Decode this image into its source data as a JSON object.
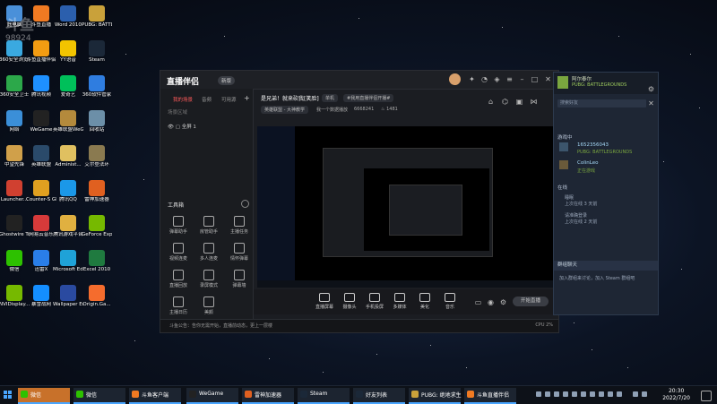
{
  "desktop_icons": [
    {
      "label": "此电脑",
      "color": "#4a90d9"
    },
    {
      "label": "斗鱼直播",
      "color": "#f07a22"
    },
    {
      "label": "Word 2010",
      "color": "#2b5fad"
    },
    {
      "label": "PUBG: BATTLEGROUNDS",
      "color": "#c9a13a"
    },
    {
      "label": "360安全浏览器",
      "color": "#3aa9e0"
    },
    {
      "label": "斗鱼直播伴侣",
      "color": "#f39c12"
    },
    {
      "label": "YY语音",
      "color": "#f2c400"
    },
    {
      "label": "Steam",
      "color": "#1b2838"
    },
    {
      "label": "360安全卫士",
      "color": "#2ca84a"
    },
    {
      "label": "腾讯视频",
      "color": "#1e90ff"
    },
    {
      "label": "爱奇艺",
      "color": "#00c05a"
    },
    {
      "label": "360软件管家",
      "color": "#2f7de0"
    },
    {
      "label": "网络",
      "color": "#3b8fd8"
    },
    {
      "label": "WeGame",
      "color": "#222"
    },
    {
      "label": "英雄联盟WeGame版",
      "color": "#b48a3c"
    },
    {
      "label": "回收站",
      "color": "#6c8fa8"
    },
    {
      "label": "中望先锋",
      "color": "#d0a04a"
    },
    {
      "label": "英雄联盟",
      "color": "#2a4a6a"
    },
    {
      "label": "Administ...",
      "color": "#e0c060"
    },
    {
      "label": "艾尔登法环",
      "color": "#8a7a50"
    },
    {
      "label": "Launcher...",
      "color": "#d04030"
    },
    {
      "label": "Counter-S Global Off...",
      "color": "#e0a020"
    },
    {
      "label": "腾讯QQ",
      "color": "#1b98e8"
    },
    {
      "label": "雷神加速器",
      "color": "#e06020"
    },
    {
      "label": "Ghostwire Tokyo",
      "color": "#222"
    },
    {
      "label": "网易云音乐",
      "color": "#d63a3a"
    },
    {
      "label": "腾讯游戏平台",
      "color": "#e0b040"
    },
    {
      "label": "GeForce Experience",
      "color": "#76b900"
    },
    {
      "label": "微信",
      "color": "#2dc100"
    },
    {
      "label": "迅雷X",
      "color": "#2a7ee8"
    },
    {
      "label": "Microsoft Edge",
      "color": "#1fa2d8"
    },
    {
      "label": "Excel 2010",
      "color": "#1f7a3f"
    },
    {
      "label": "NVIDisplay...",
      "color": "#76b900"
    },
    {
      "label": "暴雪战网",
      "color": "#148eff"
    },
    {
      "label": "Wallpaper Engine...",
      "color": "#2a4aa0"
    },
    {
      "label": "Origin.Ga...",
      "color": "#f56c2d"
    }
  ],
  "watermark": {
    "brand": "斗鱼",
    "room": "98924"
  },
  "broadcaster": {
    "title": "直播伴侣",
    "version_tag": "新版",
    "left_tabs": [
      "我的场景",
      "音频",
      "可用源"
    ],
    "scene_name": "全屏 1",
    "scene_group": "场景区域",
    "tools_title": "工具箱",
    "tools": [
      "弹幕助手",
      "房管助手",
      "主播任务",
      "视频连麦",
      "多人连麦",
      "情怀弹幕",
      "直播回放",
      "录屏模式",
      "弹幕墙",
      "主播日历",
      "美颜"
    ],
    "room_title": "是兄弟！就来砍我[笑脸]",
    "room_tag": "单机",
    "room_desc": "#我用直播伴侣开播#",
    "category": "英雄联盟 - 大神教学",
    "room_id_label": "我一个数据播放",
    "room_id": "6668241",
    "fans": "1481",
    "bottom_actions": [
      "直播屏幕",
      "摄像头",
      "手机投屏",
      "多媒体",
      "美化",
      "音乐"
    ],
    "start_button": "开始直播",
    "status_text": "斗鱼公告：告你无需开始，直播前动态，更上一层楼",
    "status_right": "CPU 2%"
  },
  "steam": {
    "user": "阿尔泰尔",
    "status": "PUBG: BATTLEGROUNDS",
    "search_placeholder": "搜索好友",
    "in_game_title": "游戏中",
    "friend1_id": "1652356043",
    "friend1_game": "PUBG: BATTLEGROUNDS",
    "friend2_name": "ColinLeo",
    "friend2_sub": "正在游戏",
    "online_title": "在线",
    "offline_items": [
      "睡眠",
      "上次在线 3 天前",
      "请准确登录",
      "上次在线 2 天前"
    ],
    "chat_header": "群组聊天",
    "chat_text": "加入群组来讨论，加入 Steam 群组吧"
  },
  "taskbar": {
    "items": [
      {
        "label": "微信",
        "color": "#2dc100"
      },
      {
        "label": "微信",
        "color": "#2dc100"
      },
      {
        "label": "斗鱼客户端",
        "color": "#f07a22"
      },
      {
        "label": "WeGame",
        "color": "#222"
      },
      {
        "label": "雷神加速器",
        "color": "#e06020"
      },
      {
        "label": "Steam",
        "color": "#1b2838"
      },
      {
        "label": "好友列表",
        "color": "#1b2838"
      },
      {
        "label": "PUBG: 绝地求生",
        "color": "#c9a13a"
      },
      {
        "label": "斗鱼直播伴侣",
        "color": "#f07a22"
      }
    ],
    "time": "20:30",
    "date": "2022/7/20"
  }
}
